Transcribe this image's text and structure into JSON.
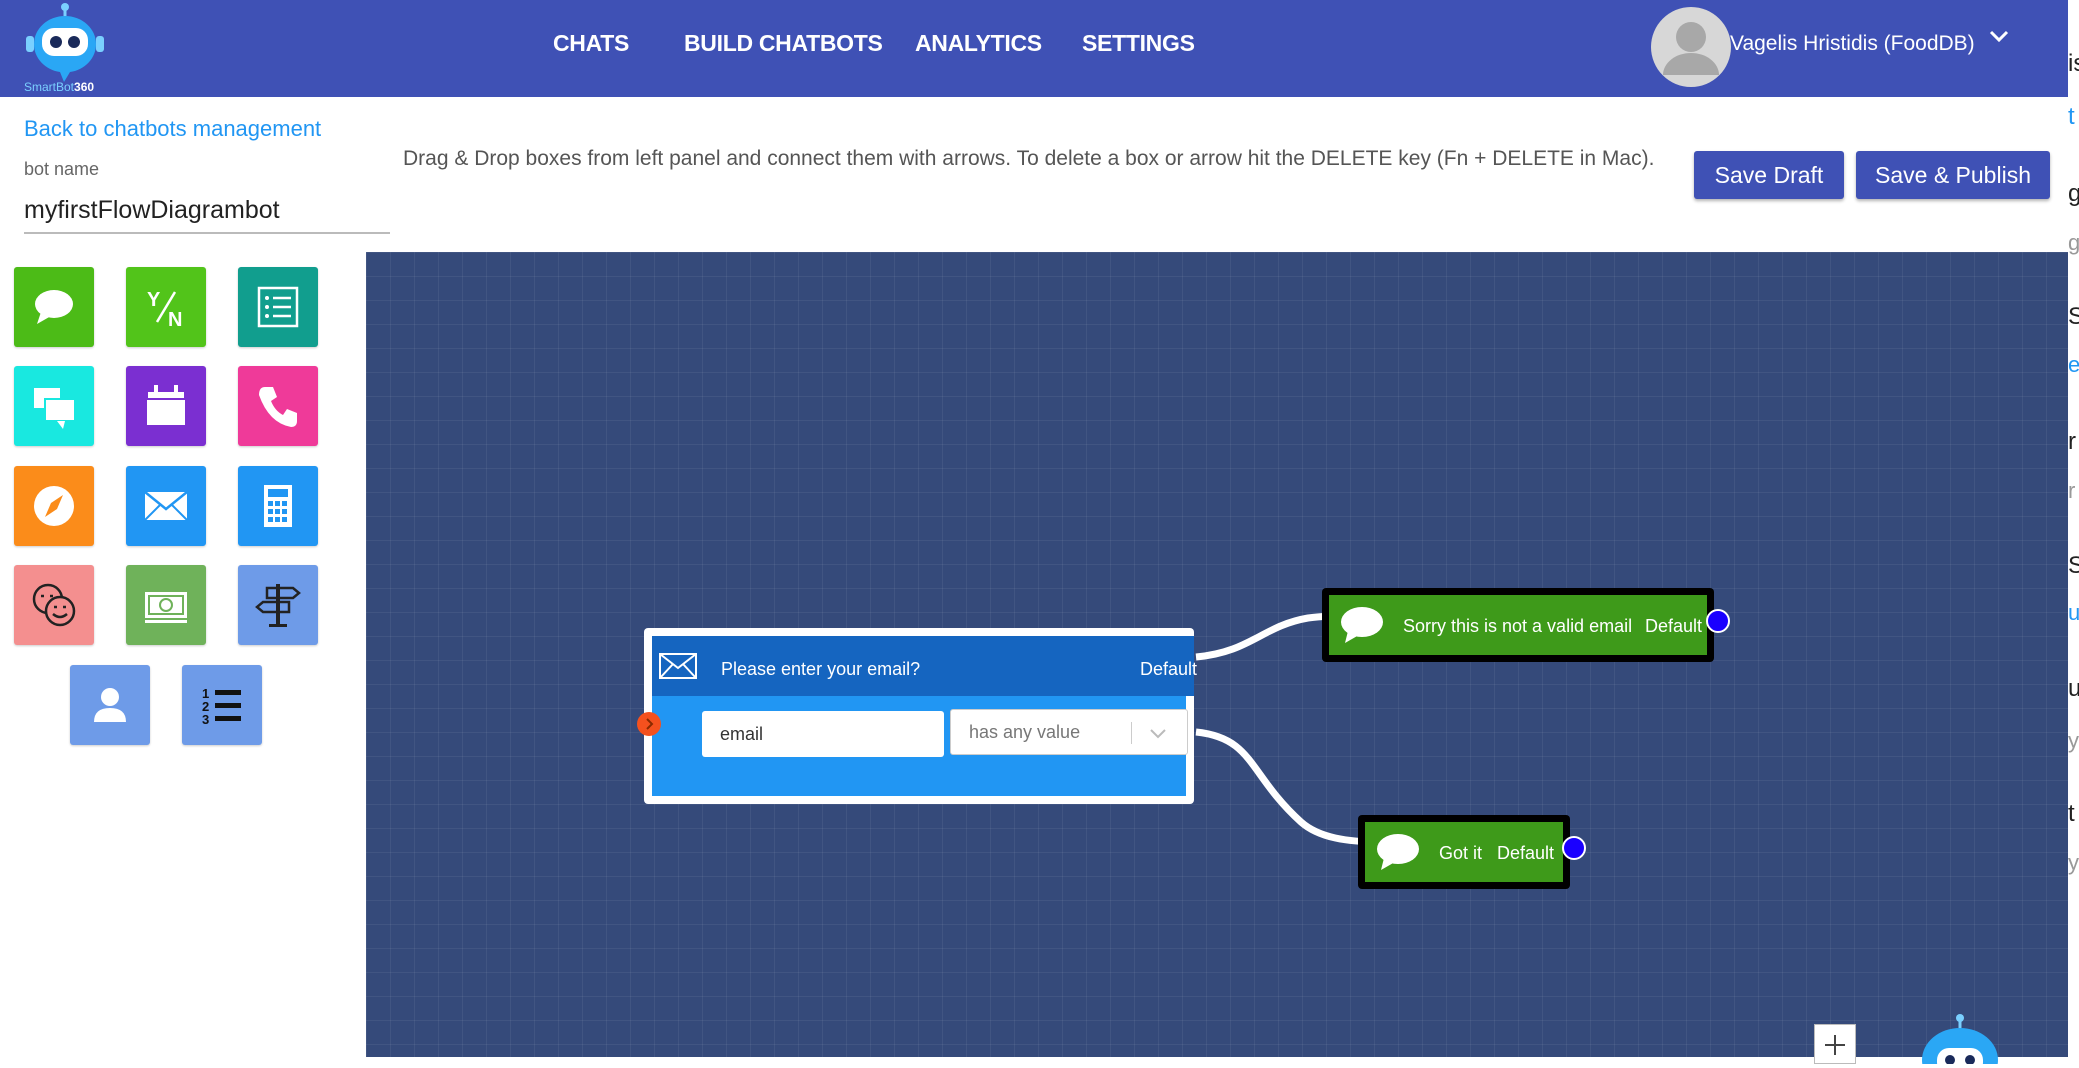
{
  "header": {
    "logo_text_a": "SmartBot",
    "logo_text_b": "360",
    "nav": [
      "CHATS",
      "BUILD CHATBOTS",
      "ANALYTICS",
      "SETTINGS"
    ],
    "user_name": "Vagelis Hristidis (FoodDB)"
  },
  "editor": {
    "back_link": "Back to chatbots management",
    "bot_name_label": "bot name",
    "bot_name_value": "myfirstFlowDiagrambot",
    "instructions": "Drag & Drop boxes from left panel and connect them with arrows. To delete a box or arrow hit the DELETE key (Fn + DELETE in Mac).",
    "save_draft": "Save Draft",
    "save_publish": "Save & Publish"
  },
  "palette": [
    {
      "icon": "speech-bubble-icon",
      "color": "#4cbb17"
    },
    {
      "icon": "yes-no-icon",
      "color": "#52c41a"
    },
    {
      "icon": "list-icon",
      "color": "#119e8e"
    },
    {
      "icon": "multi-chat-icon",
      "color": "#19e8e0"
    },
    {
      "icon": "calendar-icon",
      "color": "#7b2fd1"
    },
    {
      "icon": "phone-icon",
      "color": "#ef3a99"
    },
    {
      "icon": "compass-icon",
      "color": "#fb8c1a"
    },
    {
      "icon": "email-icon",
      "color": "#2196f3"
    },
    {
      "icon": "calculator-icon",
      "color": "#2196f3"
    },
    {
      "icon": "faces-icon",
      "color": "#f48f8f"
    },
    {
      "icon": "money-icon",
      "color": "#6fb25a"
    },
    {
      "icon": "signpost-icon",
      "color": "#6e9be8"
    },
    {
      "icon": "person-icon",
      "color": "#6e9be8"
    },
    {
      "icon": "numbered-list-icon",
      "color": "#6e9be8"
    }
  ],
  "flow": {
    "email_node": {
      "title": "Please enter your email?",
      "default_label": "Default",
      "condition_field": "email",
      "condition_operator": "has any value"
    },
    "invalid_node": {
      "text": "Sorry this is not a valid email",
      "default_label": "Default"
    },
    "valid_node": {
      "text": "Got it",
      "default_label": "Default"
    }
  },
  "right_edge": {
    "letters": [
      "is",
      "t",
      "g",
      "g",
      "Sl",
      "e",
      "r",
      "r",
      "Sl",
      "u",
      "u",
      "y",
      "t",
      "y"
    ]
  }
}
